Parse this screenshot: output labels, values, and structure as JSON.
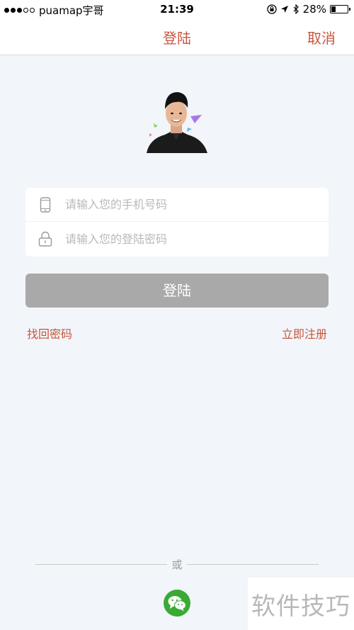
{
  "status_bar": {
    "carrier": "puamap宇哥",
    "time": "21:39",
    "battery": "28%",
    "battery_level": 0.28
  },
  "nav": {
    "title": "登陆",
    "cancel_label": "取消"
  },
  "form": {
    "phone_placeholder": "请输入您的手机号码",
    "phone_value": "",
    "password_placeholder": "请输入您的登陆密码",
    "password_value": ""
  },
  "login_button_label": "登陆",
  "links": {
    "forgot": "找回密码",
    "register": "立即注册"
  },
  "divider_text": "或",
  "watermark": "软件技巧",
  "colors": {
    "accent": "#c8553d",
    "button_disabled": "#a9a9a9",
    "wechat": "#3aaa35",
    "background": "#f2f5f9"
  }
}
